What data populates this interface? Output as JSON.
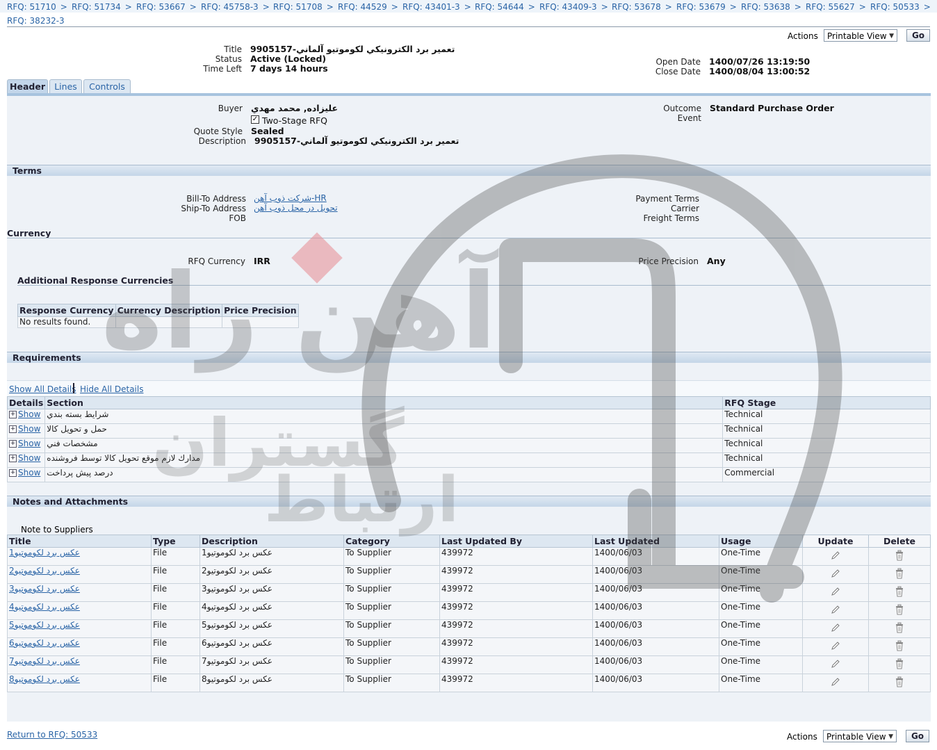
{
  "breadcrumbs": [
    "RFQ: 51710",
    "RFQ: 51734",
    "RFQ: 53667",
    "RFQ: 45758-3",
    "RFQ: 51708",
    "RFQ: 44529",
    "RFQ: 43401-3",
    "RFQ: 54644",
    "RFQ: 43409-3",
    "RFQ: 53678",
    "RFQ: 53679",
    "RFQ: 53638",
    "RFQ: 55627",
    "RFQ: 50533"
  ],
  "breadcrumb_sep": ">",
  "current_page": "RFQ: 38232-3",
  "actions": {
    "label": "Actions",
    "selected": "Printable View",
    "go": "Go"
  },
  "summary": {
    "title_label": "Title",
    "title": "تعمير برد الكترونيكي لكوموتيو آلماني-9905157",
    "status_label": "Status",
    "status": "Active (Locked)",
    "time_left_label": "Time Left",
    "time_left": "7 days 14 hours",
    "open_date_label": "Open Date",
    "open_date": "1400/07/26 13:19:50",
    "close_date_label": "Close Date",
    "close_date": "1400/08/04 13:00:52"
  },
  "tabs": [
    "Header",
    "Lines",
    "Controls"
  ],
  "header": {
    "buyer_label": "Buyer",
    "buyer": "عليزاده, محمد مهدي",
    "two_stage": "Two-Stage RFQ",
    "quote_style_label": "Quote Style",
    "quote_style": "Sealed",
    "description_label": "Description",
    "description": "تعمير برد الكترونيكي لكوموتيو آلماني-9905157",
    "outcome_label": "Outcome",
    "outcome": "Standard Purchase Order",
    "event_label": "Event"
  },
  "terms": {
    "heading": "Terms",
    "bill_to_label": "Bill-To Address",
    "bill_to": "شركت ذوب آهن-HR",
    "ship_to_label": "Ship-To Address",
    "ship_to": "تحويل در محل ذوب آهن",
    "fob_label": "FOB",
    "payment_terms_label": "Payment Terms",
    "carrier_label": "Carrier",
    "freight_terms_label": "Freight Terms"
  },
  "currency": {
    "heading": "Currency",
    "rfq_currency_label": "RFQ Currency",
    "rfq_currency": "IRR",
    "price_precision_label": "Price Precision",
    "price_precision": "Any",
    "additional_heading": "Additional Response Currencies",
    "columns": [
      "Response Currency",
      "Currency Description",
      "Price Precision"
    ],
    "empty": "No results found."
  },
  "requirements": {
    "heading": "Requirements",
    "show_all": "Show All Details",
    "hide_all": "Hide All Details",
    "columns": [
      "Details",
      "Section",
      "RFQ Stage"
    ],
    "show_label": "Show",
    "rows": [
      {
        "section": "شرايط بسته بندي",
        "stage": "Technical"
      },
      {
        "section": "حمل و تحويل كالا",
        "stage": "Technical"
      },
      {
        "section": "مشخصات فني",
        "stage": "Technical"
      },
      {
        "section": "مدارك لازم موقع تحويل كالا توسط فروشنده",
        "stage": "Technical"
      },
      {
        "section": "درصد پيش پرداخت",
        "stage": "Commercial"
      }
    ]
  },
  "notes": {
    "heading": "Notes and Attachments",
    "note_to_suppliers": "Note to Suppliers",
    "columns": [
      "Title",
      "Type",
      "Description",
      "Category",
      "Last Updated By",
      "Last Updated",
      "Usage",
      "Update",
      "Delete"
    ],
    "rows": [
      {
        "title": "عكس برد لكوموتيو1",
        "type": "File",
        "description": "عكس برد لكوموتيو1",
        "category": "To Supplier",
        "by": "439972",
        "updated": "1400/06/03",
        "usage": "One-Time"
      },
      {
        "title": "عكس برد لكوموتيو2",
        "type": "File",
        "description": "عكس برد لكوموتيو2",
        "category": "To Supplier",
        "by": "439972",
        "updated": "1400/06/03",
        "usage": "One-Time"
      },
      {
        "title": "عكس برد لكوموتيو3",
        "type": "File",
        "description": "عكس برد لكوموتيو3",
        "category": "To Supplier",
        "by": "439972",
        "updated": "1400/06/03",
        "usage": "One-Time"
      },
      {
        "title": "عكس برد لكوموتيو4",
        "type": "File",
        "description": "عكس برد لكوموتيو4",
        "category": "To Supplier",
        "by": "439972",
        "updated": "1400/06/03",
        "usage": "One-Time"
      },
      {
        "title": "عكس برد لكوموتيو5",
        "type": "File",
        "description": "عكس برد لكوموتيو5",
        "category": "To Supplier",
        "by": "439972",
        "updated": "1400/06/03",
        "usage": "One-Time"
      },
      {
        "title": "عكس برد لكوموتيو6",
        "type": "File",
        "description": "عكس برد لكوموتيو6",
        "category": "To Supplier",
        "by": "439972",
        "updated": "1400/06/03",
        "usage": "One-Time"
      },
      {
        "title": "عكس برد لكوموتيو7",
        "type": "File",
        "description": "عكس برد لكوموتيو7",
        "category": "To Supplier",
        "by": "439972",
        "updated": "1400/06/03",
        "usage": "One-Time"
      },
      {
        "title": "عكس برد لكوموتيو8",
        "type": "File",
        "description": "عكس برد لكوموتيو8",
        "category": "To Supplier",
        "by": "439972",
        "updated": "1400/06/03",
        "usage": "One-Time"
      }
    ]
  },
  "footer": {
    "return_link": "Return to RFQ: 50533"
  },
  "watermark": {
    "line1": "آهن راه",
    "line2": "گستران",
    "line3": "ارتباط"
  }
}
